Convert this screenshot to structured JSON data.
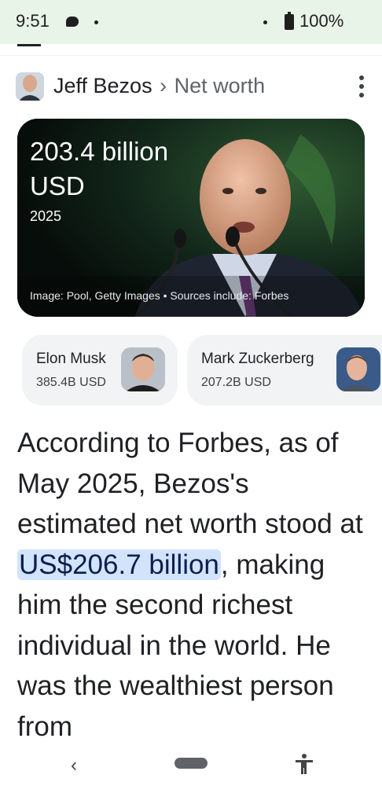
{
  "status_bar": {
    "time": "9:51",
    "battery_percent": "100%",
    "icons": [
      "chat-icon",
      "dot-icon",
      "dot-icon",
      "battery-icon"
    ]
  },
  "header": {
    "entity": "Jeff Bezos",
    "separator": "›",
    "attribute": "Net worth",
    "more_icon": "more-vert-icon"
  },
  "hero": {
    "value": "203.4 billion USD",
    "year": "2025",
    "caption": "Image: Pool, Getty Images • Sources include: Forbes"
  },
  "related_people": [
    {
      "name": "Elon Musk",
      "net_worth": "385.4B USD"
    },
    {
      "name": "Mark Zuckerberg",
      "net_worth": "207.2B USD"
    }
  ],
  "answer": {
    "before": "According to Forbes, as of May 2025, Bezos's estimated net worth stood at ",
    "highlight": "US$206.7 billion",
    "after": ", making him the second richest individual in the world. He was the wealthiest person from"
  },
  "colors": {
    "status_bar_bg": "#e9f4e9",
    "card_bg": "#f1f3f4",
    "highlight_bg": "#d2e3fc",
    "hero_bg": "#0d1a14"
  },
  "nav_bar": {
    "icons": [
      "back-icon",
      "home-pill",
      "accessibility-icon"
    ]
  }
}
